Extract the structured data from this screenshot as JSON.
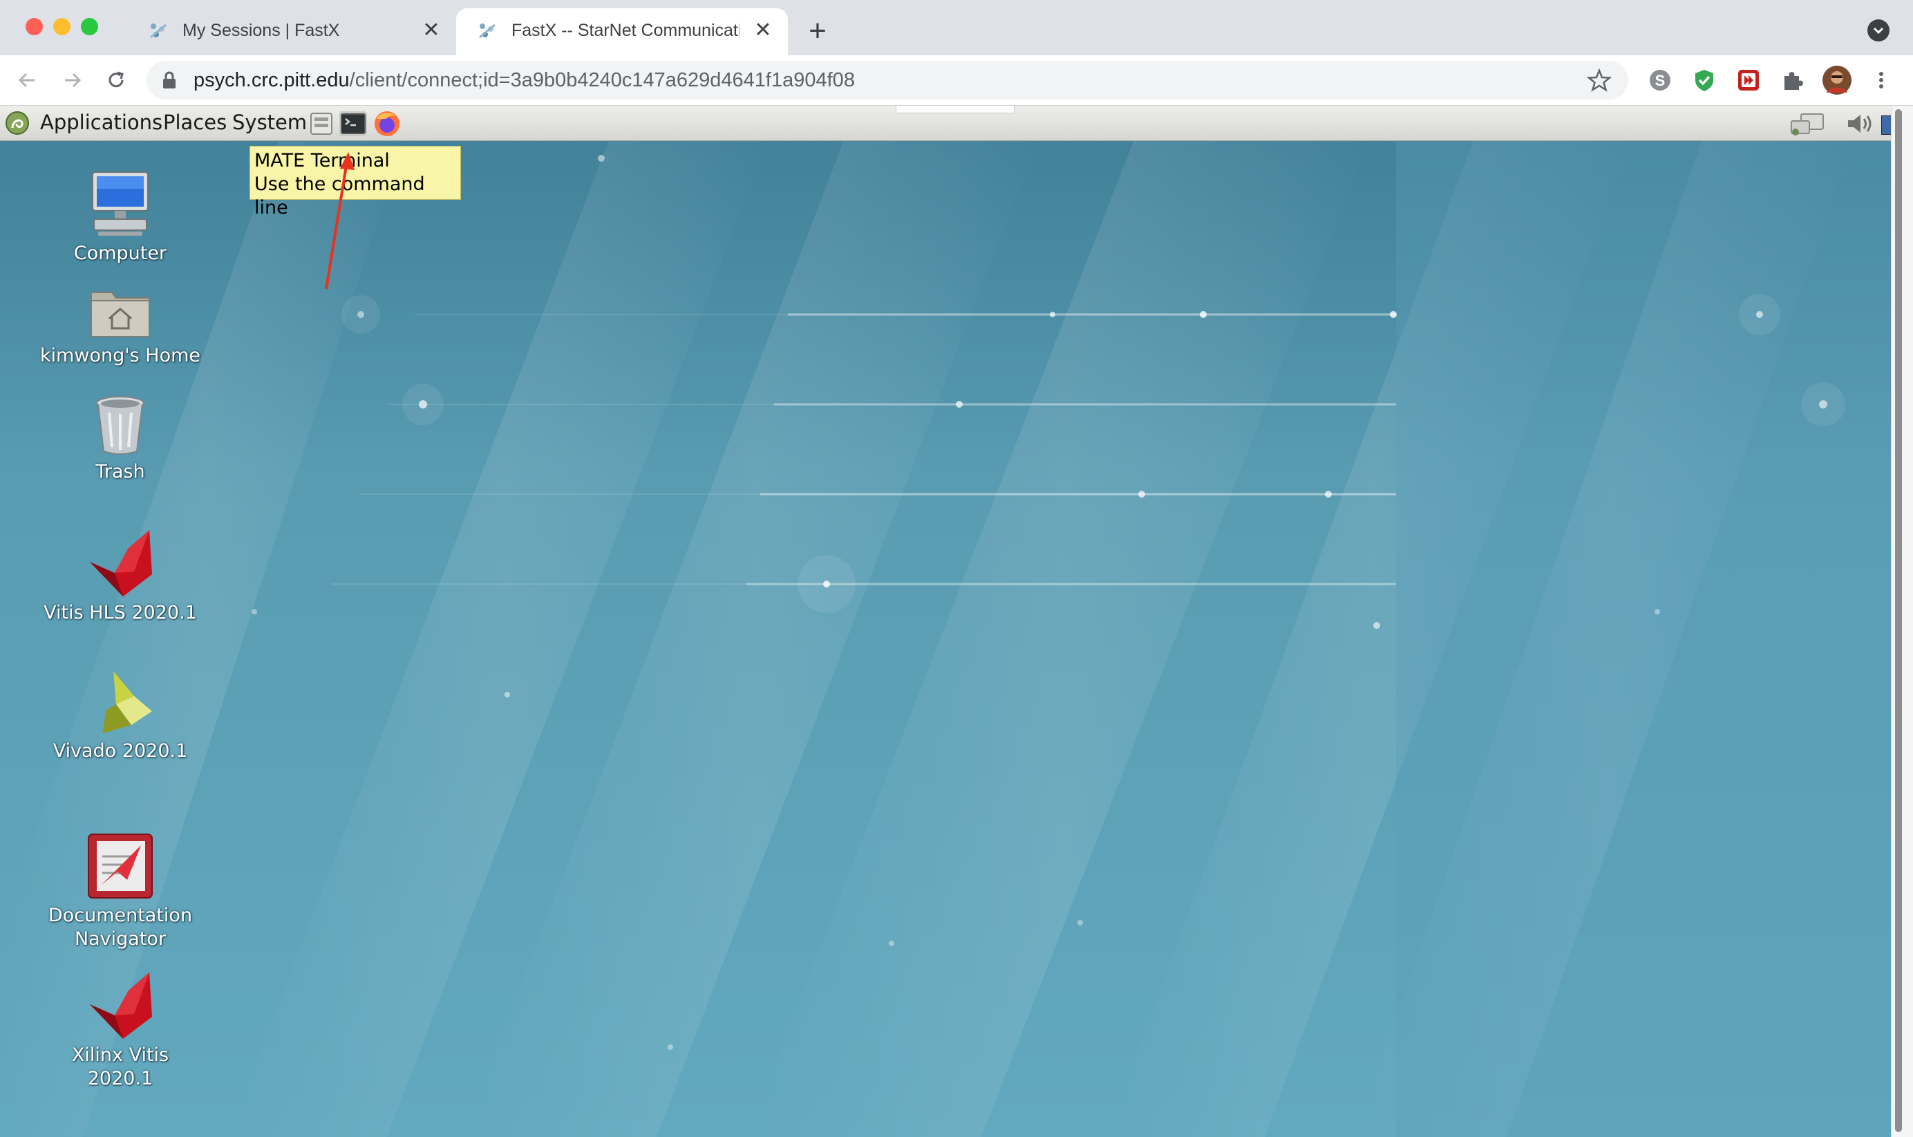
{
  "browser": {
    "tabs": [
      {
        "title": "My Sessions | FastX",
        "active": false,
        "close": "✕"
      },
      {
        "title": "FastX -- StarNet Communicatio",
        "active": true,
        "close": "✕"
      }
    ],
    "new_tab_label": "+",
    "address": {
      "host": "psych.crc.pitt.edu",
      "path": "/client/connect;id=3a9b0b4240c147a629d4641f1a904f08"
    },
    "extensions": [
      "skype-icon",
      "shield-check-icon",
      "video-speed-icon",
      "puzzle-icon",
      "profile-avatar"
    ]
  },
  "panel": {
    "menus": {
      "applications": "Applications",
      "places": "Places",
      "system": "System"
    },
    "launchers": [
      "file-manager-icon",
      "terminal-icon",
      "firefox-icon"
    ],
    "tray": [
      "network-icon",
      "volume-icon"
    ]
  },
  "tooltip": {
    "title": "MATE Terminal",
    "description": "Use the command line"
  },
  "desktop_icons": [
    {
      "label": "Computer",
      "icon": "computer-icon"
    },
    {
      "label": "kimwong's Home",
      "icon": "home-folder-icon"
    },
    {
      "label": "Trash",
      "icon": "trash-icon"
    },
    {
      "label": "Vitis HLS 2020.1",
      "icon": "vitis-icon"
    },
    {
      "label": "Vivado 2020.1",
      "icon": "vivado-icon"
    },
    {
      "label_line1": "Documentation",
      "label_line2": "Navigator",
      "icon": "docnav-icon"
    },
    {
      "label": "Xilinx Vitis 2020.1",
      "icon": "vitis-icon"
    }
  ],
  "colors": {
    "desktop": "#4d8ea6",
    "tooltip_bg": "#f8f4a8",
    "annotation_arrow": "#e8321e",
    "xilinx_red": "#c8101e"
  }
}
